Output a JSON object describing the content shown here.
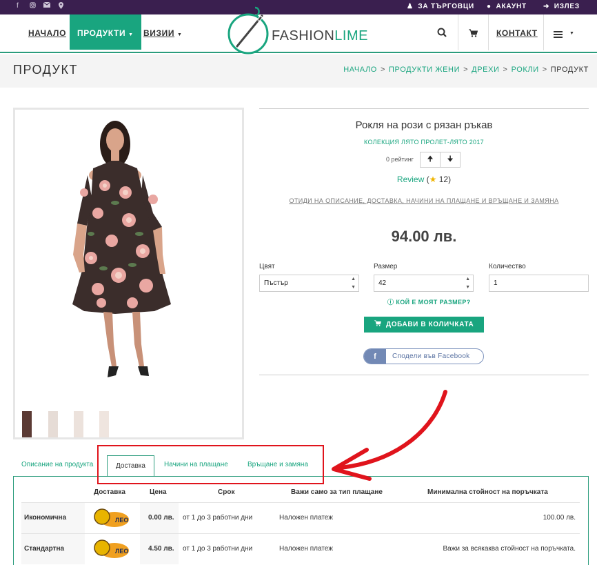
{
  "topbar": {
    "social_icons": [
      "facebook-icon",
      "instagram-icon",
      "mail-icon",
      "location-icon"
    ],
    "links": [
      {
        "label": "ЗА ТЪРГОВЦИ",
        "icon": "users-icon"
      },
      {
        "label": "АКАУНТ",
        "icon": "user-icon"
      },
      {
        "label": "ИЗЛЕЗ",
        "icon": "logout-icon"
      }
    ]
  },
  "nav": {
    "home": "НАЧАЛО",
    "products": "ПРОДУКТИ",
    "cards": "ВИЗИИ",
    "logo_part1": "FASHION",
    "logo_part2": "LIME",
    "contact": "КОНТАКТ"
  },
  "titlebar": {
    "title": "ПРОДУКТ",
    "breadcrumbs": [
      "НАЧАЛО",
      "ПРОДУКТИ ЖЕНИ",
      "ДРЕХИ",
      "РОКЛИ",
      "ПРОДУКТ"
    ]
  },
  "product": {
    "name": "Рокля на рози с рязан ръкав",
    "collection": "КОЛЕКЦИЯ ЛЯТО ПРОЛЕТ-ЛЯТО 2017",
    "rating_text": "0 рейтинг",
    "review_label": "Review",
    "review_count": "12",
    "goto_link": "ОТИДИ НА ОПИСАНИЕ, ДОСТАВКА, НАЧИНИ НА ПЛАЩАНЕ И ВРЪЩАНЕ И ЗАМЯНА",
    "price": "94.00 лв.",
    "color_label": "Цвят",
    "color_value": "Пъстър",
    "size_label": "Размер",
    "size_value": "42",
    "qty_label": "Количество",
    "qty_value": "1",
    "size_help": "КОЙ Е МОЯТ РАЗМЕР?",
    "add_button": "ДОБАВИ В КОЛИЧКАТА",
    "share_button": "Сподели във Facebook",
    "thumbnail_count": 4
  },
  "tabs": [
    {
      "label": "Описание на продукта",
      "active": false
    },
    {
      "label": "Доставка",
      "active": true
    },
    {
      "label": "Начини на плащане",
      "active": false
    },
    {
      "label": "Връщане и замяна",
      "active": false
    }
  ],
  "delivery_table": {
    "headers": [
      "Доставка",
      "Цена",
      "Срок",
      "Важи само за тип плащане",
      "Минимална стойност на поръчката"
    ],
    "rows": [
      {
        "name": "Икономична",
        "courier": "ЛЕО",
        "price": "0.00 лв.",
        "term": "от 1 до 3 работни дни",
        "payment": "Наложен платеж",
        "min": "100.00 лв."
      },
      {
        "name": "Стандартна",
        "courier": "ЛЕО",
        "price": "4.50 лв.",
        "term": "от 1 до 3 работни дни",
        "payment": "Наложен платеж",
        "min": "Важи за всякаква стойност на поръчката."
      }
    ]
  },
  "colors": {
    "brand_green": "#19a57f",
    "topbar_purple": "#3a1f4f",
    "highlight_red": "#e0141c"
  }
}
